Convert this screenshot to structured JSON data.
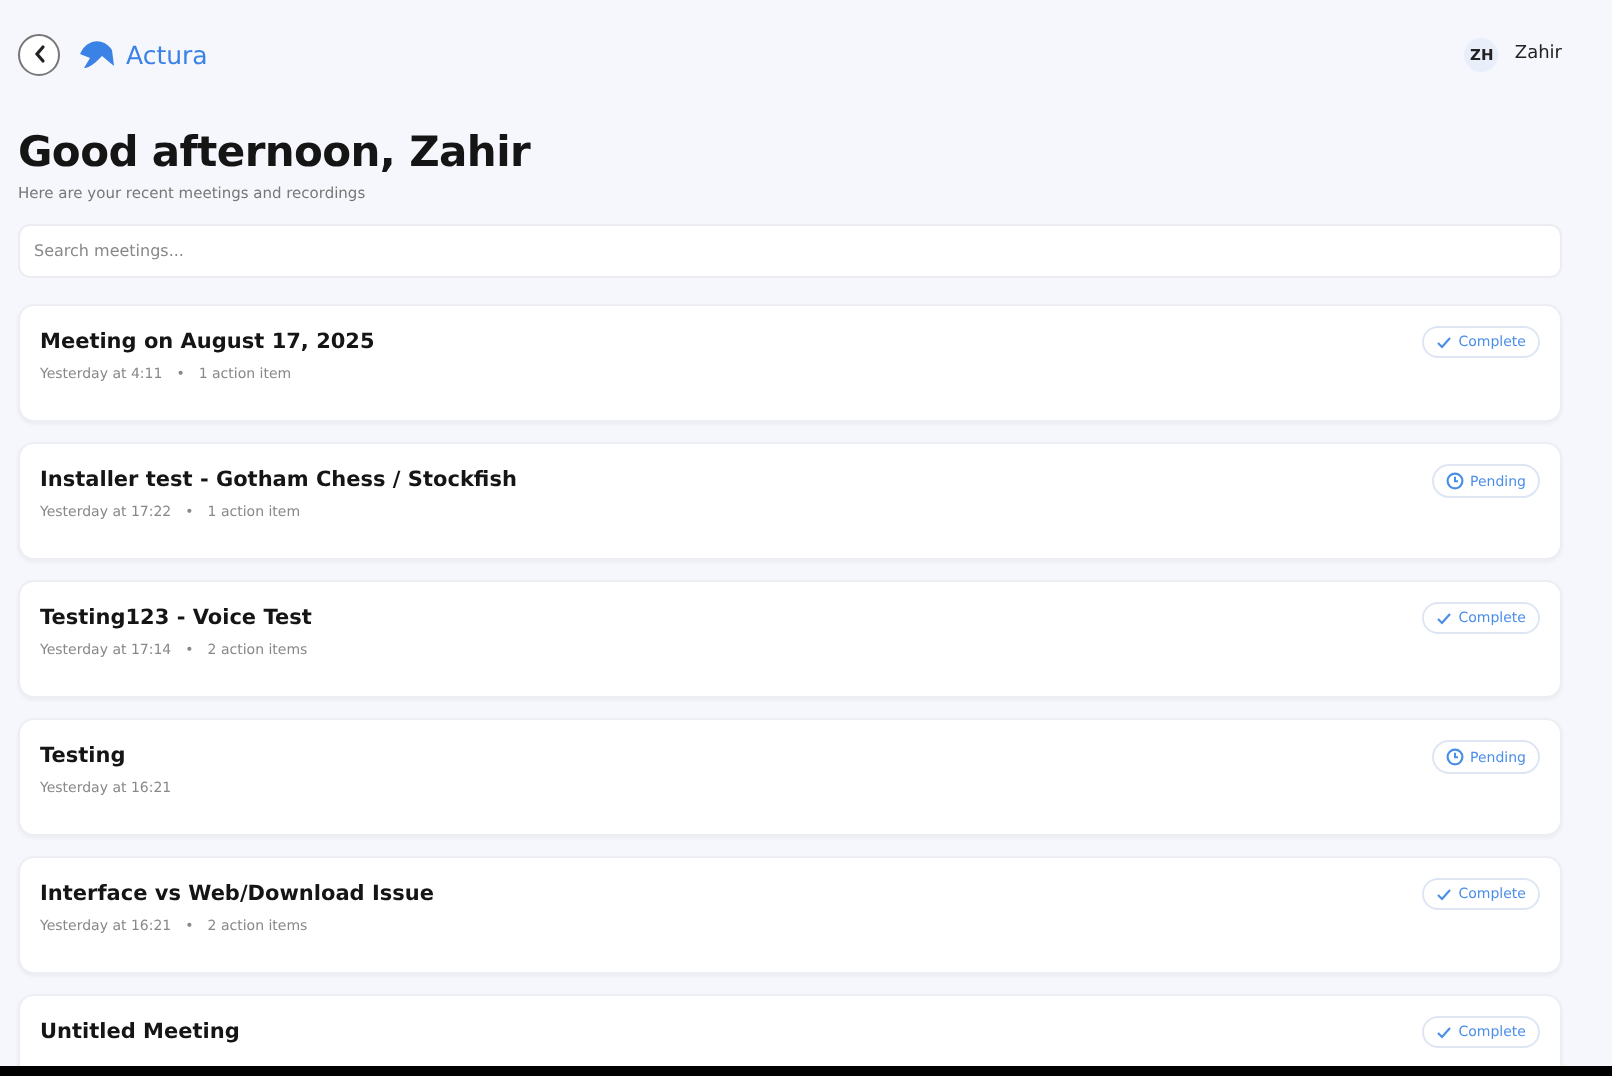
{
  "header": {
    "brand": "Actura",
    "user": {
      "initials": "ZH",
      "name": "Zahir"
    }
  },
  "greeting": "Good afternoon, Zahir",
  "subtitle": "Here are your recent meetings and recordings",
  "search": {
    "placeholder": "Search meetings..."
  },
  "meetings": [
    {
      "title": "Meeting on August 17, 2025",
      "time": "Yesterday at 4:11",
      "separator": "•",
      "actions": "1 action item",
      "status": {
        "kind": "complete",
        "label": "Complete"
      }
    },
    {
      "title": "Installer test - Gotham Chess / Stockfish",
      "time": "Yesterday at 17:22",
      "separator": "•",
      "actions": "1 action item",
      "status": {
        "kind": "pending",
        "label": "Pending"
      }
    },
    {
      "title": "Testing123 - Voice Test",
      "time": "Yesterday at 17:14",
      "separator": "•",
      "actions": "2 action items",
      "status": {
        "kind": "complete",
        "label": "Complete"
      }
    },
    {
      "title": "Testing",
      "time": "Yesterday at 16:21",
      "status": {
        "kind": "pending",
        "label": "Pending"
      }
    },
    {
      "title": "Interface vs Web/Download Issue",
      "time": "Yesterday at 16:21",
      "separator": "•",
      "actions": "2 action items",
      "status": {
        "kind": "complete",
        "label": "Complete"
      }
    },
    {
      "title": "Untitled Meeting",
      "status": {
        "kind": "complete",
        "label": "Complete"
      }
    }
  ]
}
